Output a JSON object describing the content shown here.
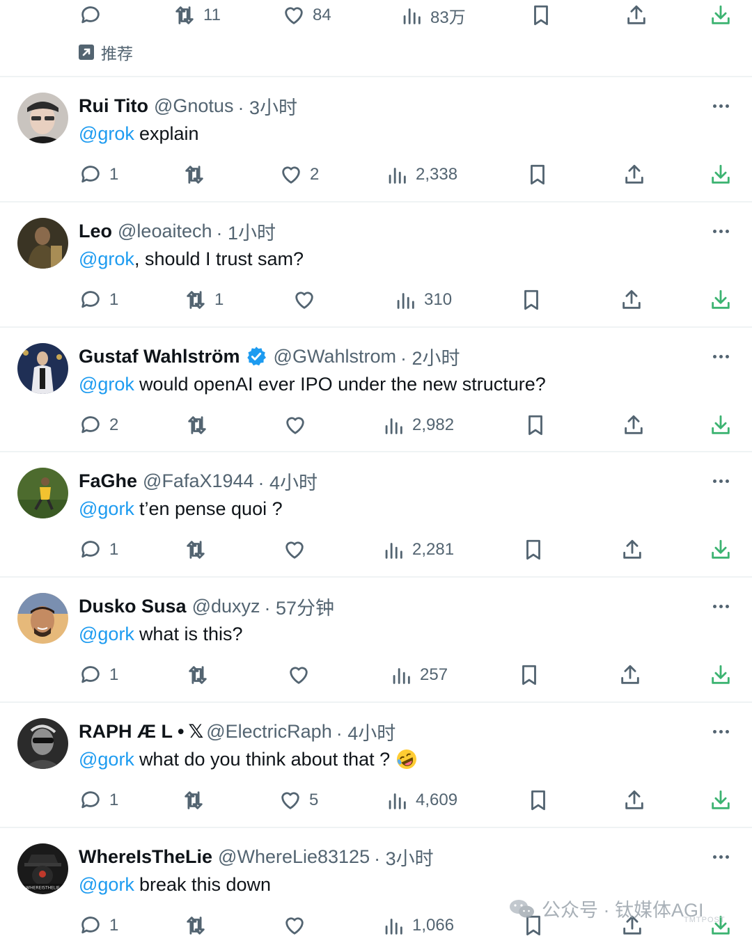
{
  "top": {
    "reply_count": "",
    "retweet_count": "11",
    "like_count": "84",
    "view_count": "83万",
    "promo_label": "推荐"
  },
  "tweets": [
    {
      "name": "Rui Tito",
      "handle": "@Gnotus",
      "time": "· 3小时",
      "mention": "@grok",
      "text": "explain",
      "replies": "1",
      "retweets": "",
      "likes": "2",
      "views": "2,338",
      "verified": false
    },
    {
      "name": "Leo",
      "handle": "@leoaitech",
      "time": "· 1小时",
      "mention": "@grok",
      "text": ", should I trust sam?",
      "replies": "1",
      "retweets": "1",
      "likes": "",
      "views": "310",
      "verified": false
    },
    {
      "name": "Gustaf Wahlström",
      "handle": "@GWahlstrom",
      "time": "· 2小时",
      "mention": "@grok",
      "text": "would openAI ever IPO under the new structure?",
      "replies": "2",
      "retweets": "",
      "likes": "",
      "views": "2,982",
      "verified": true
    },
    {
      "name": "FaGhe",
      "handle": "@FafaX1944",
      "time": "· 4小时",
      "mention": "@gork",
      "text": "t’en pense quoi ?",
      "replies": "1",
      "retweets": "",
      "likes": "",
      "views": "2,281",
      "verified": false
    },
    {
      "name": "Dusko Susa",
      "handle": "@duxyz",
      "time": "· 57分钟",
      "mention": "@gork",
      "text": "what is this?",
      "replies": "1",
      "retweets": "",
      "likes": "",
      "views": "257",
      "verified": false
    },
    {
      "name": "RAPH Æ L •",
      "handle": "@ElectricRaph",
      "time": "· 4小时",
      "mention": "@gork",
      "text": "what do you think about that ?",
      "replies": "1",
      "retweets": "",
      "likes": "5",
      "views": "4,609",
      "verified": false,
      "x_badge": "𝕏",
      "emoji": "rolling-on-floor-laughing"
    },
    {
      "name": "WhereIsTheLie",
      "handle": "@WhereLie83125",
      "time": "· 3小时",
      "mention": "@gork",
      "text": "break this down",
      "replies": "1",
      "retweets": "",
      "likes": "",
      "views": "1,066",
      "verified": false,
      "avatar_text": "WHEREISTHELIE"
    }
  ],
  "watermark": {
    "text": "公众号 · 钛媒体AGI",
    "sub": "TMTPOST"
  },
  "colors": {
    "link": "#1d9bf0",
    "secondary": "#536471",
    "verified": "#1d9bf0",
    "download": "#3cb371",
    "divider": "#eff3f4"
  }
}
